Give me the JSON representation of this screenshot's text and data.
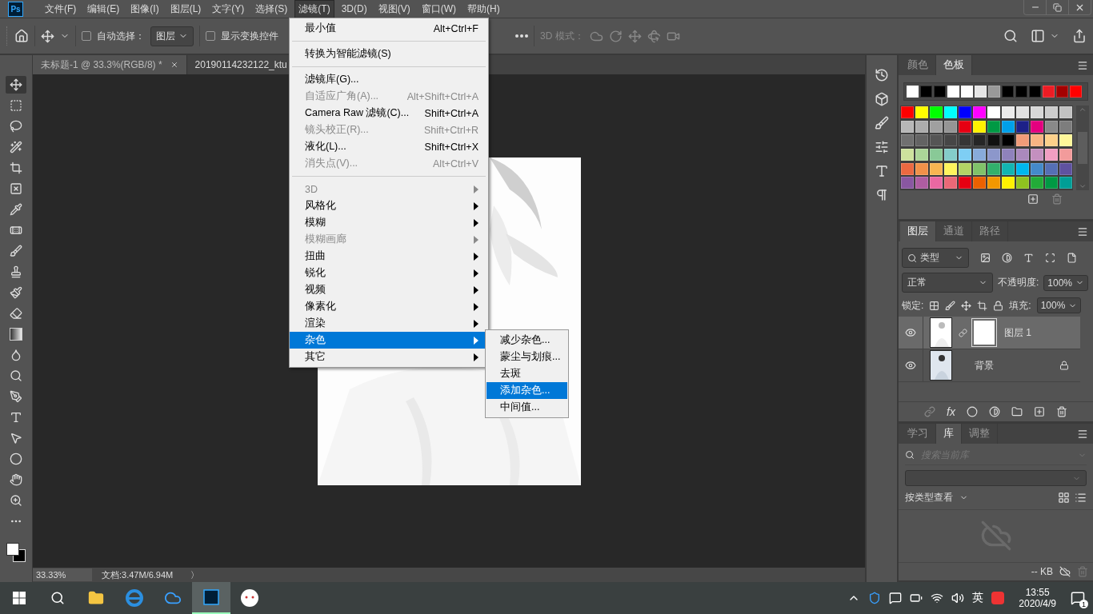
{
  "app": {
    "logo": "Ps"
  },
  "menu_bar": [
    {
      "label": "文件(F)",
      "selected": false
    },
    {
      "label": "编辑(E)",
      "selected": false
    },
    {
      "label": "图像(I)",
      "selected": false
    },
    {
      "label": "图层(L)",
      "selected": false
    },
    {
      "label": "文字(Y)",
      "selected": false
    },
    {
      "label": "选择(S)",
      "selected": false
    },
    {
      "label": "滤镜(T)",
      "selected": true
    },
    {
      "label": "3D(D)",
      "selected": false
    },
    {
      "label": "视图(V)",
      "selected": false
    },
    {
      "label": "窗口(W)",
      "selected": false
    },
    {
      "label": "帮助(H)",
      "selected": false
    }
  ],
  "options_bar": {
    "auto_select": {
      "label": "自动选择：",
      "checked": false
    },
    "target": "图层",
    "show_transform": {
      "label": "显示变换控件",
      "checked": false
    },
    "mode_3d": "3D 模式："
  },
  "documents": [
    {
      "title": "未标题-1 @ 33.3%(RGB/8) *",
      "selected": true
    },
    {
      "title": "20190114232122_ktu",
      "selected": false
    }
  ],
  "status_bar": {
    "zoom": "33.33%",
    "doc": "文档:3.47M/6.94M",
    "arrow": "〉"
  },
  "filter_menu": [
    {
      "kind": "command",
      "label": "最小值",
      "shortcut": "Alt+Ctrl+F",
      "disabled": false,
      "selected": false
    },
    {
      "kind": "separator"
    },
    {
      "kind": "command",
      "label": "转换为智能滤镜(S)",
      "disabled": false,
      "selected": false
    },
    {
      "kind": "separator"
    },
    {
      "kind": "command",
      "label": "滤镜库(G)...",
      "disabled": false,
      "selected": false
    },
    {
      "kind": "command",
      "label": "自适应广角(A)...",
      "shortcut": "Alt+Shift+Ctrl+A",
      "disabled": true,
      "selected": false
    },
    {
      "kind": "command",
      "label": "Camera Raw 滤镜(C)...",
      "shortcut": "Shift+Ctrl+A",
      "disabled": false,
      "selected": false
    },
    {
      "kind": "command",
      "label": "镜头校正(R)...",
      "shortcut": "Shift+Ctrl+R",
      "disabled": true,
      "selected": false
    },
    {
      "kind": "command",
      "label": "液化(L)...",
      "shortcut": "Shift+Ctrl+X",
      "disabled": false,
      "selected": false
    },
    {
      "kind": "command",
      "label": "消失点(V)...",
      "shortcut": "Alt+Ctrl+V",
      "disabled": true,
      "selected": false
    },
    {
      "kind": "separator"
    },
    {
      "kind": "submenu",
      "label": "3D",
      "disabled": true,
      "selected": false
    },
    {
      "kind": "submenu",
      "label": "风格化",
      "disabled": false,
      "selected": false
    },
    {
      "kind": "submenu",
      "label": "模糊",
      "disabled": false,
      "selected": false
    },
    {
      "kind": "submenu",
      "label": "模糊画廊",
      "disabled": true,
      "selected": false
    },
    {
      "kind": "submenu",
      "label": "扭曲",
      "disabled": false,
      "selected": false
    },
    {
      "kind": "submenu",
      "label": "锐化",
      "disabled": false,
      "selected": false
    },
    {
      "kind": "submenu",
      "label": "视频",
      "disabled": false,
      "selected": false
    },
    {
      "kind": "submenu",
      "label": "像素化",
      "disabled": false,
      "selected": false
    },
    {
      "kind": "submenu",
      "label": "渲染",
      "disabled": false,
      "selected": false
    },
    {
      "kind": "submenu",
      "label": "杂色",
      "disabled": false,
      "selected": true
    },
    {
      "kind": "submenu",
      "label": "其它",
      "disabled": false,
      "selected": false
    }
  ],
  "noise_submenu": [
    {
      "label": "减少杂色...",
      "selected": false
    },
    {
      "label": "蒙尘与划痕...",
      "selected": false
    },
    {
      "label": "去斑",
      "selected": false
    },
    {
      "label": "添加杂色...",
      "selected": true
    },
    {
      "label": "中间值...",
      "selected": false
    }
  ],
  "swatch_panel": {
    "tabs": [
      {
        "label": "颜色",
        "selected": false
      },
      {
        "label": "色板",
        "selected": true
      }
    ],
    "recent": [
      {
        "color": "#ffffff"
      },
      {
        "color": "#000000"
      },
      {
        "color": "#000000"
      },
      {
        "color": "#ffffff"
      },
      {
        "color": "#fcfcfc"
      },
      {
        "color": "#e6e6e6"
      },
      {
        "color": "#999999"
      },
      {
        "color": "#000000"
      },
      {
        "color": "#000000"
      },
      {
        "color": "#000000"
      },
      {
        "color": "#ed1c24"
      },
      {
        "color": "#a40000"
      },
      {
        "color": "#ff0000"
      }
    ],
    "swatches": [
      {
        "color": "#ff0000"
      },
      {
        "color": "#ffff00"
      },
      {
        "color": "#00ff00"
      },
      {
        "color": "#00ffff"
      },
      {
        "color": "#0000ff"
      },
      {
        "color": "#ff00ff"
      },
      {
        "color": "#ffffff"
      },
      {
        "color": "#ebebeb"
      },
      {
        "color": "#e1e1e1"
      },
      {
        "color": "#d7d7d7"
      },
      {
        "color": "#cccccc"
      },
      {
        "color": "#c2c2c2"
      },
      {
        "color": "#b7b7b7"
      },
      {
        "color": "#acacac"
      },
      {
        "color": "#a0a0a0"
      },
      {
        "color": "#959595"
      },
      {
        "color": "#e60012"
      },
      {
        "color": "#fff100"
      },
      {
        "color": "#009944"
      },
      {
        "color": "#00a0e9"
      },
      {
        "color": "#1d2088"
      },
      {
        "color": "#e4007f"
      },
      {
        "color": "#898989"
      },
      {
        "color": "#7d7d7d"
      },
      {
        "color": "#707070"
      },
      {
        "color": "#636363"
      },
      {
        "color": "#555555"
      },
      {
        "color": "#464646"
      },
      {
        "color": "#363636"
      },
      {
        "color": "#262626"
      },
      {
        "color": "#111111"
      },
      {
        "color": "#000000"
      },
      {
        "color": "#f19c79"
      },
      {
        "color": "#f7b583"
      },
      {
        "color": "#fcd08a"
      },
      {
        "color": "#fff799"
      },
      {
        "color": "#cde29d"
      },
      {
        "color": "#acd598"
      },
      {
        "color": "#89c997"
      },
      {
        "color": "#84ccc9"
      },
      {
        "color": "#7ecef4"
      },
      {
        "color": "#88abda"
      },
      {
        "color": "#8c97cb"
      },
      {
        "color": "#8f82bc"
      },
      {
        "color": "#aa89bd"
      },
      {
        "color": "#c490bf"
      },
      {
        "color": "#f19ec2"
      },
      {
        "color": "#f29b9b"
      },
      {
        "color": "#eb6941"
      },
      {
        "color": "#f19149"
      },
      {
        "color": "#f8b551"
      },
      {
        "color": "#fff45c"
      },
      {
        "color": "#b3d465"
      },
      {
        "color": "#80c269"
      },
      {
        "color": "#32b16c"
      },
      {
        "color": "#13b5b1"
      },
      {
        "color": "#00b7ee"
      },
      {
        "color": "#448aca"
      },
      {
        "color": "#556fb5"
      },
      {
        "color": "#5f52a0"
      },
      {
        "color": "#8957a1"
      },
      {
        "color": "#ae5da1"
      },
      {
        "color": "#ea68a2"
      },
      {
        "color": "#eb6877"
      },
      {
        "color": "#e60012"
      },
      {
        "color": "#eb6100"
      },
      {
        "color": "#f39800"
      },
      {
        "color": "#fff100"
      },
      {
        "color": "#8fc31f"
      },
      {
        "color": "#22ac38"
      },
      {
        "color": "#009944"
      },
      {
        "color": "#009e96"
      }
    ]
  },
  "layers_panel": {
    "tabs": [
      {
        "label": "图层",
        "selected": true
      },
      {
        "label": "通道",
        "selected": false
      },
      {
        "label": "路径",
        "selected": false
      }
    ],
    "filter": "类型",
    "blend_mode": "正常",
    "opacity_label": "不透明度:",
    "opacity": "100%",
    "lock_label": "锁定:",
    "fill_label": "填充:",
    "fill": "100%",
    "effects_label": "fx",
    "layers": [
      {
        "name": "图层 1",
        "selected": true,
        "visible": true,
        "locked": false,
        "mask": true
      },
      {
        "name": "背景",
        "selected": false,
        "visible": true,
        "locked": true,
        "mask": false
      }
    ]
  },
  "library_panel": {
    "tabs": [
      {
        "label": "学习",
        "selected": false
      },
      {
        "label": "库",
        "selected": true
      },
      {
        "label": "调整",
        "selected": false
      }
    ],
    "search_placeholder": "搜索当前库",
    "view_label": "按类型查看",
    "size": "-- KB"
  },
  "taskbar": {
    "ime": "英",
    "time": "13:55",
    "date": "2020/4/9",
    "notifications": "1"
  }
}
